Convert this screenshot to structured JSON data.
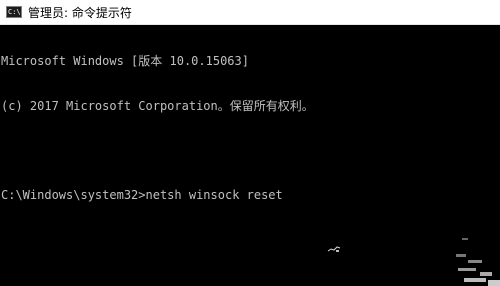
{
  "window": {
    "icon_label": "C:\\",
    "title": "管理员: 命令提示符"
  },
  "console": {
    "lines": [
      "Microsoft Windows [版本 10.0.15063]",
      "(c) 2017 Microsoft Corporation。保留所有权利。",
      "",
      "C:\\Windows\\system32>netsh winsock reset"
    ]
  },
  "colors": {
    "console_bg": "#000000",
    "console_text": "#c0c0c0",
    "titlebar_bg": "#ffffff"
  },
  "icons": [
    "cmd-icon"
  ]
}
